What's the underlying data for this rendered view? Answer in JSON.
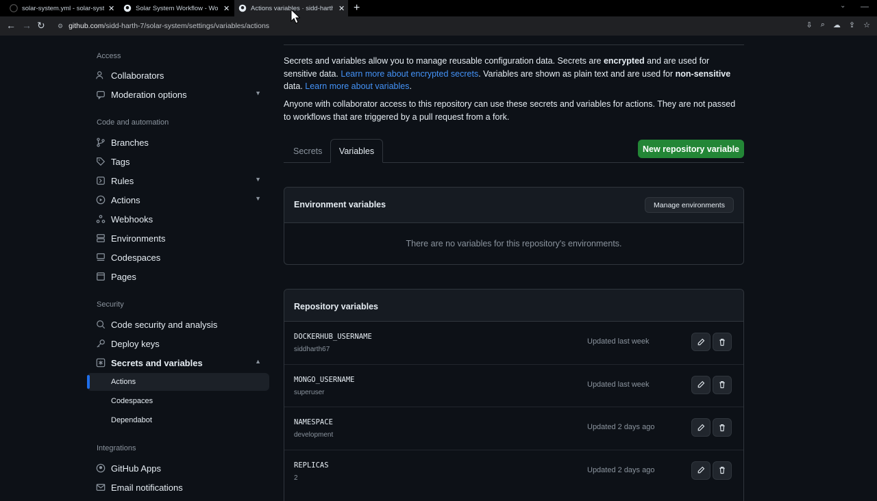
{
  "browser": {
    "tabs": [
      {
        "title": "solar-system.yml - solar-system",
        "active": false
      },
      {
        "title": "Solar System Workflow - Workfl",
        "active": false
      },
      {
        "title": "Actions variables · sidd-harth-7/",
        "active": true
      }
    ],
    "new_tab": "+",
    "url_host": "github.com",
    "url_path": "/sidd-harth-7/solar-system/settings/variables/actions"
  },
  "sidebar": {
    "sections": [
      {
        "heading": "Access"
      },
      {
        "heading": "Code and automation"
      },
      {
        "heading": "Security"
      },
      {
        "heading": "Integrations"
      }
    ],
    "items": {
      "collaborators": "Collaborators",
      "moderation": "Moderation options",
      "branches": "Branches",
      "tags": "Tags",
      "rules": "Rules",
      "actions": "Actions",
      "webhooks": "Webhooks",
      "environments": "Environments",
      "codespaces": "Codespaces",
      "pages": "Pages",
      "code_security": "Code security and analysis",
      "deploy_keys": "Deploy keys",
      "secrets_vars": "Secrets and variables",
      "sub_actions": "Actions",
      "sub_codespaces": "Codespaces",
      "sub_dependabot": "Dependabot",
      "github_apps": "GitHub Apps",
      "email_notifications": "Email notifications"
    }
  },
  "intro": {
    "p1_a": "Secrets and variables allow you to manage reusable configuration data. Secrets are ",
    "p1_b": "encrypted",
    "p1_c": " and are used for sensitive data. ",
    "p1_link1": "Learn more about encrypted secrets",
    "p1_d": ". Variables are shown as plain text and are used for ",
    "p1_e": "non-sensitive",
    "p1_f": " data. ",
    "p1_link2": "Learn more about variables",
    "p1_g": ".",
    "p2": "Anyone with collaborator access to this repository can use these secrets and variables for actions. They are not passed to workflows that are triggered by a pull request from a fork."
  },
  "tabs": {
    "secrets": "Secrets",
    "variables": "Variables"
  },
  "new_variable_button": "New repository variable",
  "env_box": {
    "title": "Environment variables",
    "manage_button": "Manage environments",
    "empty": "There are no variables for this repository's environments."
  },
  "repo_box": {
    "title": "Repository variables",
    "rows": [
      {
        "name": "DOCKERHUB_USERNAME",
        "value": "siddharth67",
        "updated": "Updated last week"
      },
      {
        "name": "MONGO_USERNAME",
        "value": "superuser",
        "updated": "Updated last week"
      },
      {
        "name": "NAMESPACE",
        "value": "development",
        "updated": "Updated 2 days ago"
      },
      {
        "name": "REPLICAS",
        "value": "2",
        "updated": "Updated 2 days ago"
      }
    ]
  },
  "colors": {
    "accent_blue": "#4493f8",
    "green_button": "#238636",
    "bg": "#0d1117"
  }
}
